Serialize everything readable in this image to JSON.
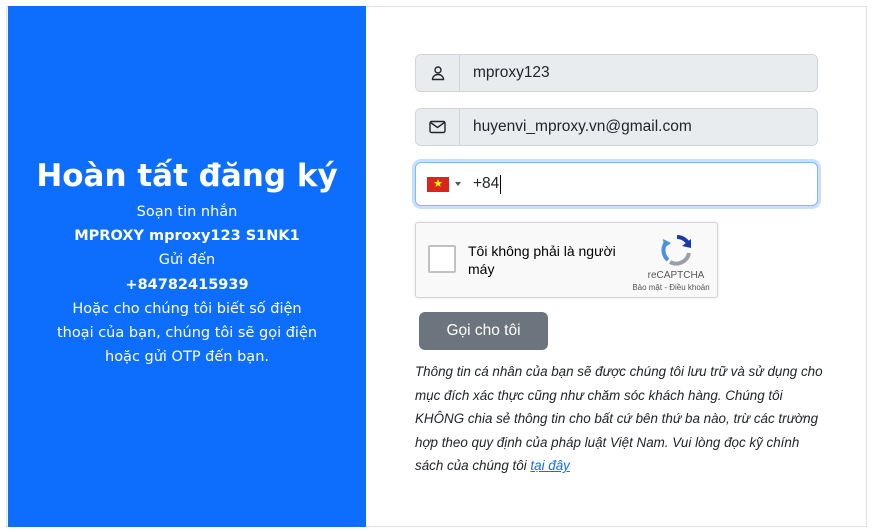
{
  "left_panel": {
    "title": "Hoàn tất đăng ký",
    "line1": "Soạn tin nhắn",
    "sms_content": "MPROXY mproxy123 S1NK1",
    "line3": "Gửi đến",
    "phone_target": "+84782415939",
    "line5": "Hoặc cho chúng tôi biết số điện",
    "line6": "thoại của bạn, chúng tôi sẽ gọi điện",
    "line7": "hoặc gửi OTP đến bạn.",
    "bg_color": "#0d6efd"
  },
  "form": {
    "username": {
      "icon": "user-icon",
      "value": "mproxy123"
    },
    "email": {
      "icon": "envelope-icon",
      "value": "huyenvi_mproxy.vn@gmail.com"
    },
    "phone": {
      "flag": "vietnam-flag-icon",
      "value": "+84"
    },
    "captcha": {
      "label": "Tôi không phải là người máy",
      "brand": "reCAPTCHA",
      "links": "Bảo mật - Điều khoản"
    },
    "call_button": "Gọi cho tôi",
    "privacy_note": "Thông tin cá nhân của bạn sẽ được chúng tôi lưu trữ và sử dụng cho mục đích xác thực cũng như chăm sóc khách hàng. Chúng tôi KHÔNG chia sẻ thông tin cho bất cứ bên thứ ba nào, trừ các trường hợp theo quy định của pháp luật Việt Nam. Vui lòng đọc kỹ chính sách của chúng tôi",
    "privacy_link": "tại đây"
  }
}
